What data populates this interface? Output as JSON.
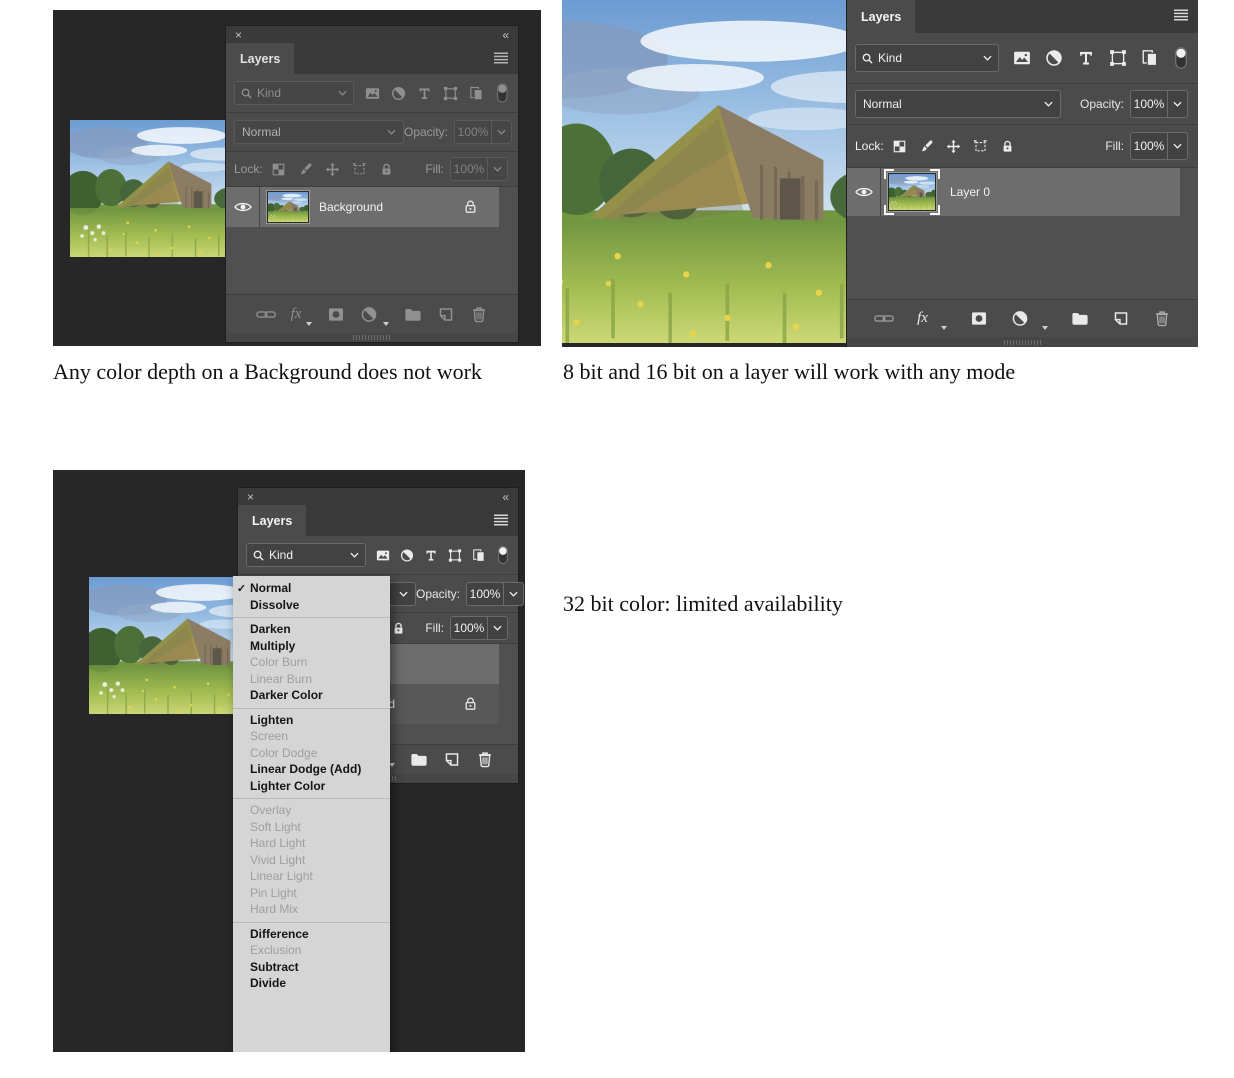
{
  "captions": {
    "top_left": "Any color depth on a Background does not work",
    "top_right": "8 bit and 16 bit on a layer will work with any mode",
    "bottom_left": "32 bit color: limited availability"
  },
  "panel_common": {
    "tab_label": "Layers",
    "close_glyph": "×",
    "collapse_glyph": "«",
    "filter_label": "Kind",
    "blend_mode_value": "Normal",
    "opacity_label": "Opacity:",
    "opacity_value": "100%",
    "lock_label": "Lock:",
    "fill_label": "Fill:",
    "fill_value": "100%",
    "fx_label": "fx"
  },
  "panels": {
    "top_left": {
      "state": "disabled",
      "layers": [
        {
          "name": "Background",
          "visible": true,
          "locked": true,
          "selected": true
        }
      ]
    },
    "top_right": {
      "state": "active",
      "layers": [
        {
          "name": "Layer 0",
          "visible": true,
          "locked": false,
          "selected": true
        }
      ]
    },
    "bottom_left": {
      "state": "active",
      "layers": [
        {
          "name": "",
          "visible": true,
          "locked": false,
          "selected": true
        },
        {
          "name": "Background",
          "visible": true,
          "locked": true,
          "selected": false
        }
      ]
    }
  },
  "blend_menu": {
    "checkmark": "✓",
    "selected": "Normal",
    "groups": [
      [
        {
          "label": "Normal",
          "enabled": true,
          "checked": true
        },
        {
          "label": "Dissolve",
          "enabled": true
        }
      ],
      [
        {
          "label": "Darken",
          "enabled": true
        },
        {
          "label": "Multiply",
          "enabled": true
        },
        {
          "label": "Color Burn",
          "enabled": false
        },
        {
          "label": "Linear Burn",
          "enabled": false
        },
        {
          "label": "Darker Color",
          "enabled": true
        }
      ],
      [
        {
          "label": "Lighten",
          "enabled": true
        },
        {
          "label": "Screen",
          "enabled": false
        },
        {
          "label": "Color Dodge",
          "enabled": false
        },
        {
          "label": "Linear Dodge (Add)",
          "enabled": true
        },
        {
          "label": "Lighter Color",
          "enabled": true
        }
      ],
      [
        {
          "label": "Overlay",
          "enabled": false
        },
        {
          "label": "Soft Light",
          "enabled": false
        },
        {
          "label": "Hard Light",
          "enabled": false
        },
        {
          "label": "Vivid Light",
          "enabled": false
        },
        {
          "label": "Linear Light",
          "enabled": false
        },
        {
          "label": "Pin Light",
          "enabled": false
        },
        {
          "label": "Hard Mix",
          "enabled": false
        }
      ],
      [
        {
          "label": "Difference",
          "enabled": true
        },
        {
          "label": "Exclusion",
          "enabled": false
        },
        {
          "label": "Subtract",
          "enabled": true
        },
        {
          "label": "Divide",
          "enabled": true
        }
      ]
    ]
  },
  "icons": [
    "close-icon",
    "collapse-icon",
    "panel-menu-icon",
    "search-icon",
    "chevron-down-icon",
    "filter-image-icon",
    "filter-adjustment-icon",
    "filter-type-icon",
    "filter-shape-icon",
    "filter-smartobject-icon",
    "filter-toggle-icon",
    "lock-transparency-icon",
    "lock-image-icon",
    "lock-position-icon",
    "lock-artboard-icon",
    "lock-all-icon",
    "eye-icon",
    "lock-icon",
    "link-icon",
    "fx-icon",
    "mask-icon",
    "adjustment-icon",
    "folder-icon",
    "new-layer-icon",
    "trash-icon"
  ],
  "colors": {
    "page_background": "#ffffff",
    "canvas": "#272727",
    "panel": "#4b4b4b",
    "titlebar": "#3a3a3a",
    "selected_row": "#6d6d6d",
    "menu_background": "#d5d5d5",
    "menu_disabled_text": "#9e9e9e",
    "active_text": "#f1f1f1",
    "dim_text": "#9a9a9a"
  }
}
